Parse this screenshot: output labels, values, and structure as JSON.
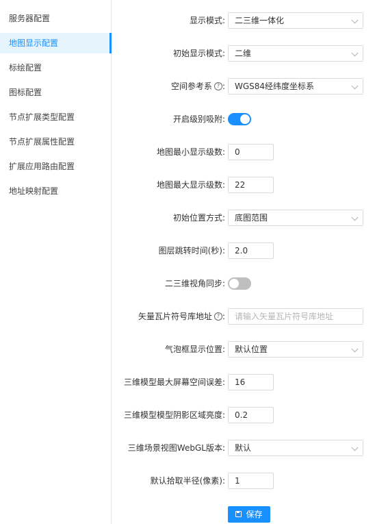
{
  "sidebar": {
    "items": [
      {
        "label": "服务器配置",
        "active": false
      },
      {
        "label": "地图显示配置",
        "active": true
      },
      {
        "label": "标绘配置",
        "active": false
      },
      {
        "label": "图标配置",
        "active": false
      },
      {
        "label": "节点扩展类型配置",
        "active": false
      },
      {
        "label": "节点扩展属性配置",
        "active": false
      },
      {
        "label": "扩展应用路由配置",
        "active": false
      },
      {
        "label": "地址映射配置",
        "active": false
      }
    ]
  },
  "form": {
    "display_mode": {
      "label": "显示模式:",
      "value": "二三维一体化"
    },
    "initial_display_mode": {
      "label": "初始显示模式:",
      "value": "二维"
    },
    "spatial_reference": {
      "label": "空间参考系",
      "value": "WGS84经纬度坐标系",
      "help_icon": "question-circle-icon"
    },
    "level_snap": {
      "label": "开启级别吸附:",
      "enabled": true
    },
    "min_zoom": {
      "label": "地图最小显示级数:",
      "value": "0"
    },
    "max_zoom": {
      "label": "地图最大显示级数:",
      "value": "22"
    },
    "initial_position": {
      "label": "初始位置方式:",
      "value": "底图范围"
    },
    "layer_jump_time": {
      "label": "图层跳转时间(秒):",
      "value": "2.0"
    },
    "view_sync": {
      "label": "二三维视角同步:",
      "enabled": false
    },
    "vector_tile_url": {
      "label": "矢量瓦片符号库地址",
      "placeholder": "请输入矢量瓦片符号库地址",
      "help_icon": "question-circle-icon"
    },
    "bubble_position": {
      "label": "气泡框显示位置:",
      "value": "默认位置"
    },
    "max_screen_error": {
      "label": "三维模型最大屏幕空间误差:",
      "value": "16"
    },
    "shadow_brightness": {
      "label": "三维模型模型阴影区域亮度:",
      "value": "0.2"
    },
    "webgl_version": {
      "label": "三维场景视图WebGL版本:",
      "value": "默认"
    },
    "pick_radius": {
      "label": "默认拾取半径(像素):",
      "value": "1"
    }
  },
  "save_button": {
    "label": "保存",
    "icon": "save-icon"
  },
  "colors": {
    "primary": "#1890ff",
    "active_bg": "#e6f4fd",
    "border": "#d9d9d9"
  }
}
